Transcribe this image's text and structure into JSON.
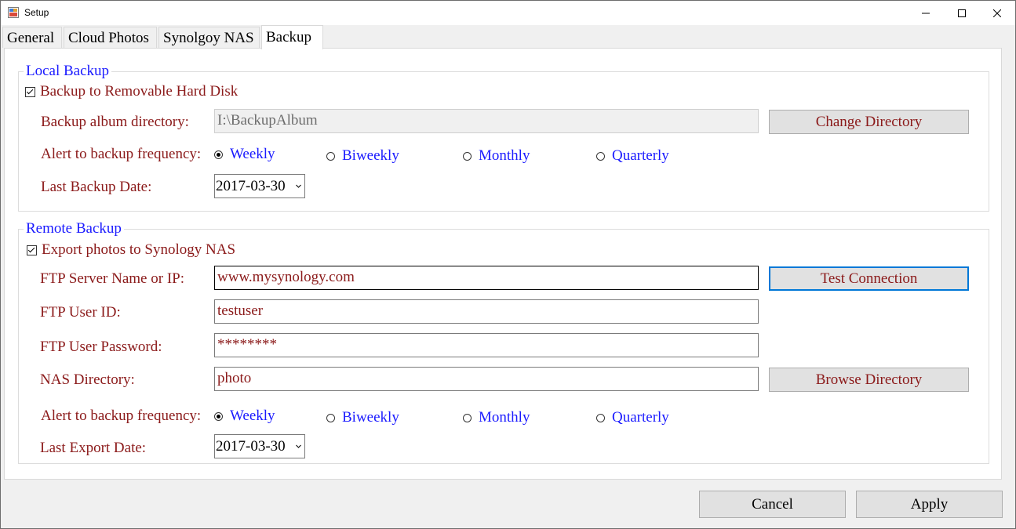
{
  "window": {
    "title": "Setup"
  },
  "tabs": [
    "General",
    "Cloud Photos",
    "Synolgoy NAS",
    "Backup"
  ],
  "local_backup": {
    "title": "Local Backup",
    "checkbox_label": "Backup to Removable Hard Disk",
    "checked": true,
    "dir_label": "Backup album directory:",
    "dir_value": "I:\\BackupAlbum",
    "change_dir_button": "Change Directory",
    "freq_label": "Alert to backup frequency:",
    "freq_options": [
      "Weekly",
      "Biweekly",
      "Monthly",
      "Quarterly"
    ],
    "freq_selected": "Weekly",
    "last_date_label": "Last Backup  Date:",
    "last_date_value": "2017-03-30"
  },
  "remote_backup": {
    "title": "Remote Backup",
    "checkbox_label": "Export photos to Synology NAS",
    "checked": true,
    "ftp_server_label": "FTP Server Name or IP:",
    "ftp_server_value": "www.mysynology.com",
    "test_button": "Test Connection",
    "ftp_user_label": "FTP User ID:",
    "ftp_user_value": "testuser",
    "ftp_pass_label": "FTP User Password:",
    "ftp_pass_value": "********",
    "nas_dir_label": "NAS Directory:",
    "nas_dir_value": "photo",
    "browse_button": "Browse Directory",
    "freq_label": "Alert to backup frequency:",
    "freq_options": [
      "Weekly",
      "Biweekly",
      "Monthly",
      "Quarterly"
    ],
    "freq_selected": "Weekly",
    "last_date_label": "Last Export Date:",
    "last_date_value": "2017-03-30"
  },
  "dialog": {
    "cancel": "Cancel",
    "apply": "Apply"
  }
}
